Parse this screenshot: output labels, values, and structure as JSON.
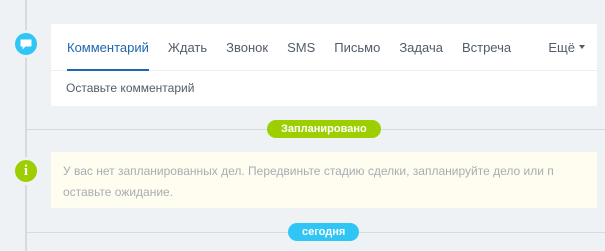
{
  "tabs": [
    {
      "label": "Комментарий",
      "active": true
    },
    {
      "label": "Ждать",
      "active": false
    },
    {
      "label": "Звонок",
      "active": false
    },
    {
      "label": "SMS",
      "active": false
    },
    {
      "label": "Письмо",
      "active": false
    },
    {
      "label": "Задача",
      "active": false
    },
    {
      "label": "Встреча",
      "active": false
    }
  ],
  "more_label": "Ещё",
  "comment_placeholder": "Оставьте комментарий",
  "planned_badge": "Запланировано",
  "notice_text": "У вас нет запланированных дел. Передвиньте стадию сделки, запланируйте дело или п оставьте ожидание.",
  "today_badge": "сегодня",
  "colors": {
    "accent_blue": "#2067b0",
    "marker_blue": "#2fc6f6",
    "marker_green": "#9dcf00",
    "notice_bg": "#fffdef"
  },
  "icons": {
    "comment_marker": "comment-icon",
    "info_marker": "info-icon"
  }
}
